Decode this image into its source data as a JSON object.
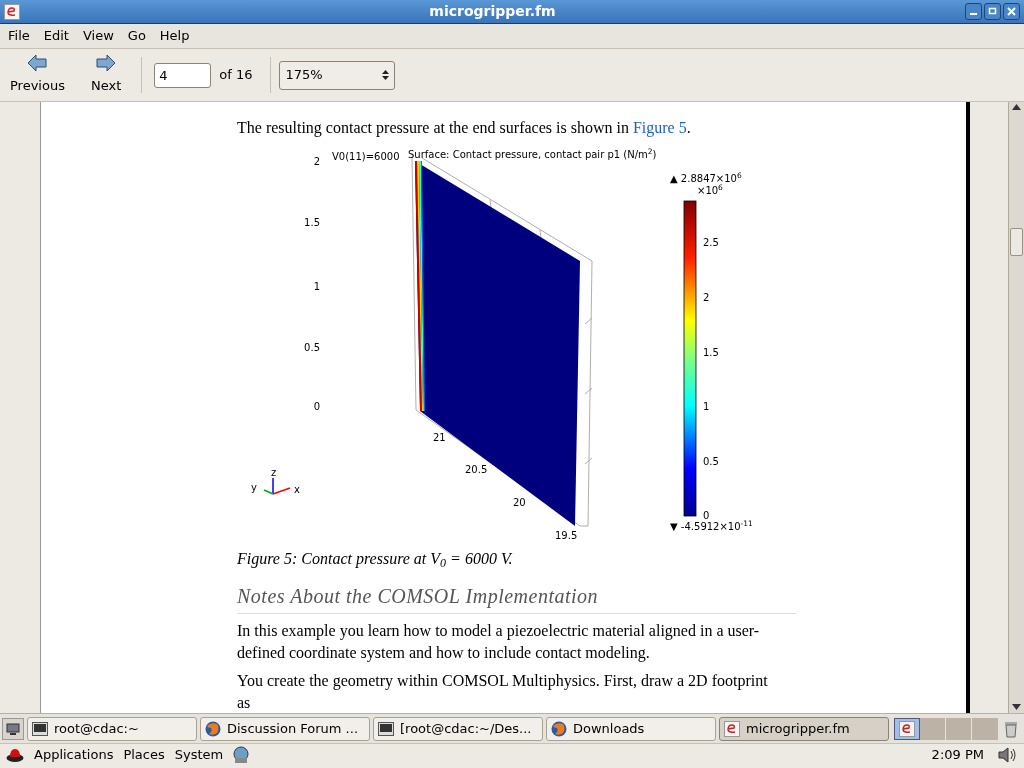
{
  "window": {
    "title": "microgripper.fm"
  },
  "menu": [
    {
      "label": "File"
    },
    {
      "label": "Edit"
    },
    {
      "label": "View"
    },
    {
      "label": "Go"
    },
    {
      "label": "Help"
    }
  ],
  "toolbar": {
    "buttons": [
      {
        "label": "Previous",
        "kind": "back"
      },
      {
        "label": "Next",
        "kind": "forward"
      }
    ],
    "page_field": {
      "value": "4"
    },
    "page_count": "of 16",
    "zoom": {
      "value": "175%"
    }
  },
  "document": {
    "intro": {
      "before": "The resulting contact pressure at the end surfaces is shown in ",
      "link": "Figure 5",
      "after": "."
    },
    "figure": {
      "run_label": "V0(11)=6000",
      "title": "Surface: Contact pressure, contact pair p1 (N/m$^{2}$)",
      "y_ticks": [
        "2",
        "1.5",
        "1",
        "0.5",
        "0"
      ],
      "x_ticks": [
        "21",
        "20.5",
        "20",
        "19.5"
      ],
      "colorbar": {
        "max": "▲ 2.8847×10$^{6}$",
        "scale": "×10$^{6}$",
        "ticks": [
          "2.5",
          "2",
          "1.5",
          "1",
          "0.5",
          "0"
        ],
        "min": "▼ -4.5912×10$^{-11}$"
      },
      "axes": [
        "z",
        "y",
        "x"
      ]
    },
    "caption": "Figure 5: Contact pressure at V$_{0}$ = 6000 V.",
    "heading": "Notes About the COMSOL Implementation",
    "paragraphs": [
      "In this example you learn how to model a piezoelectric material aligned in a user-defined coordinate system and how to include contact modeling.",
      "You create the geometry within COMSOL Multiphysics. First, draw a 2D footprint as"
    ]
  },
  "taskbar": [
    {
      "label": "root@cdac:~",
      "kind": "terminal",
      "selected": false
    },
    {
      "label": "Discussion Forum ...",
      "kind": "browser",
      "selected": false
    },
    {
      "label": "[root@cdac:~/Des...",
      "kind": "terminal",
      "selected": false
    },
    {
      "label": "Downloads",
      "kind": "browser",
      "selected": false
    },
    {
      "label": "microgripper.fm",
      "kind": "viewer",
      "selected": true
    }
  ],
  "panel": {
    "menus": [
      "Applications",
      "Places",
      "System"
    ],
    "clock": "2:09 PM"
  }
}
